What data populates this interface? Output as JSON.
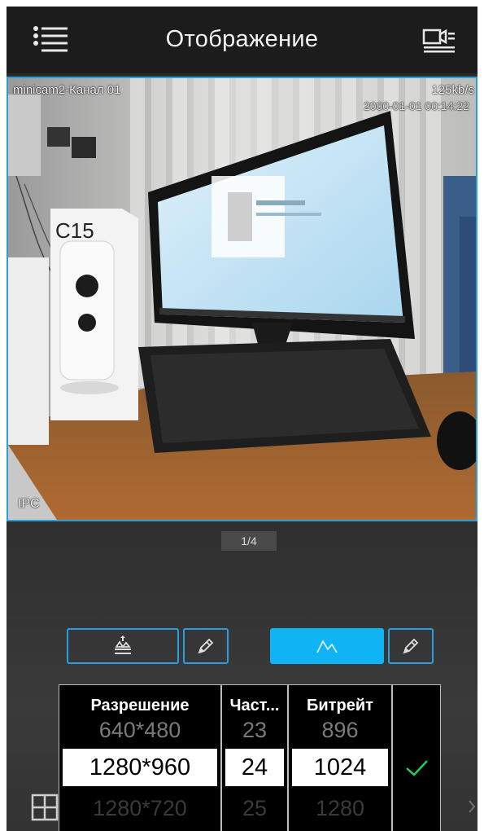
{
  "header": {
    "title": "Отображение",
    "menu_icon": "hamburger-menu-icon",
    "record_icon": "video-record-icon"
  },
  "video": {
    "channel_label": "minicam2-Канал 01",
    "bitrate": "125kb/s",
    "timestamp": "2000-01-01 00:14:22",
    "device_type": "IPC",
    "box_brand": "C15"
  },
  "pager": {
    "current": "1/4"
  },
  "stream_buttons": {
    "main_icon": "main-stream-icon",
    "sub_icon": "sub-stream-icon",
    "edit_icon": "pencil-icon",
    "active": "sub",
    "accent_color": "#10b4f4"
  },
  "picker": {
    "columns": [
      {
        "header": "Разрешение",
        "prev": "640*480",
        "selected": "1280*960",
        "next": "1280*720"
      },
      {
        "header": "Част...",
        "prev": "23",
        "selected": "24",
        "next": "25"
      },
      {
        "header": "Битрейт",
        "prev": "896",
        "selected": "1024",
        "next": "1280"
      }
    ],
    "confirm_icon": "checkmark-icon",
    "confirm_color": "#1fd05a"
  },
  "toolbar": {
    "grid_icon": "grid-layout-icon",
    "clock_icon": "clock-icon",
    "more_icon": "chevron-right-icon"
  }
}
